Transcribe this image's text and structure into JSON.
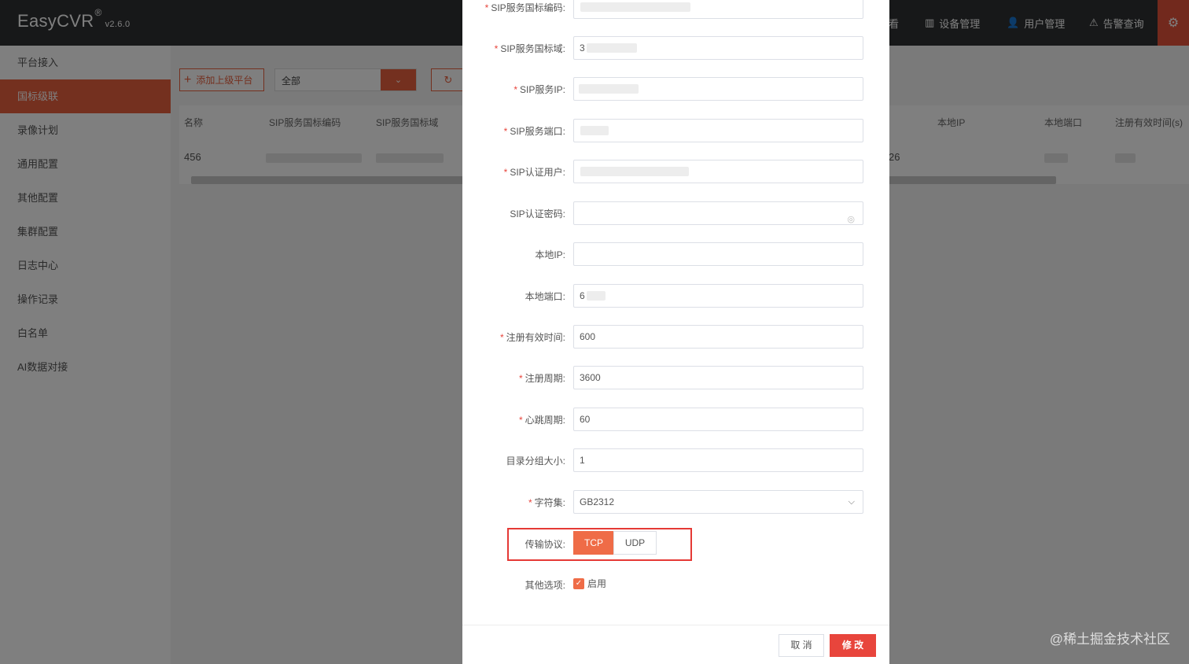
{
  "app": {
    "logo": "EasyCVR",
    "reg": "®",
    "version": "v2.6.0"
  },
  "topnav": {
    "partial_label": "看",
    "device": "设备管理",
    "user": "用户管理",
    "alarm": "告警查询"
  },
  "sidebar": {
    "items": [
      {
        "label": "平台接入"
      },
      {
        "label": "国标级联",
        "active": true
      },
      {
        "label": "录像计划"
      },
      {
        "label": "通用配置"
      },
      {
        "label": "其他配置"
      },
      {
        "label": "集群配置"
      },
      {
        "label": "日志中心"
      },
      {
        "label": "操作记录"
      },
      {
        "label": "白名单"
      },
      {
        "label": "AI数据对接"
      }
    ]
  },
  "toolbar": {
    "add_label": "添加上级平台",
    "select_value": "全部"
  },
  "table": {
    "headers": [
      "名称",
      "SIP服务国标编码",
      "SIP服务国标域",
      "本地IP",
      "本地端口",
      "注册有效时间(s)"
    ],
    "row": {
      "name": "456",
      "partial": "26"
    }
  },
  "form": {
    "sip_code": {
      "label": "SIP服务国标编码:",
      "required": true
    },
    "sip_domain": {
      "label": "SIP服务国标域:",
      "required": true,
      "value": "3"
    },
    "sip_ip": {
      "label": "SIP服务IP:",
      "required": true
    },
    "sip_port": {
      "label": "SIP服务端口:",
      "required": true
    },
    "sip_user": {
      "label": "SIP认证用户:",
      "required": true
    },
    "sip_password": {
      "label": "SIP认证密码:",
      "required": false
    },
    "local_ip": {
      "label": "本地IP:",
      "required": false,
      "value": ""
    },
    "local_port": {
      "label": "本地端口:",
      "required": false,
      "value": "6"
    },
    "reg_valid": {
      "label": "注册有效时间:",
      "required": true,
      "value": "600"
    },
    "reg_period": {
      "label": "注册周期:",
      "required": true,
      "value": "3600"
    },
    "heartbeat": {
      "label": "心跳周期:",
      "required": true,
      "value": "60"
    },
    "catalog_size": {
      "label": "目录分组大小:",
      "required": false,
      "value": "1"
    },
    "charset": {
      "label": "字符集:",
      "required": true,
      "value": "GB2312"
    },
    "protocol": {
      "label": "传输协议:",
      "options": [
        "TCP",
        "UDP"
      ],
      "selected": "TCP"
    },
    "other": {
      "label": "其他选项:",
      "checkbox_label": "启用",
      "checked": true
    }
  },
  "buttons": {
    "cancel": "取 消",
    "save": "修 改"
  },
  "colors": {
    "accent": "#e8603f",
    "danger": "#e8453c",
    "highlight_box": "#e53935"
  },
  "watermark": "@稀土掘金技术社区"
}
